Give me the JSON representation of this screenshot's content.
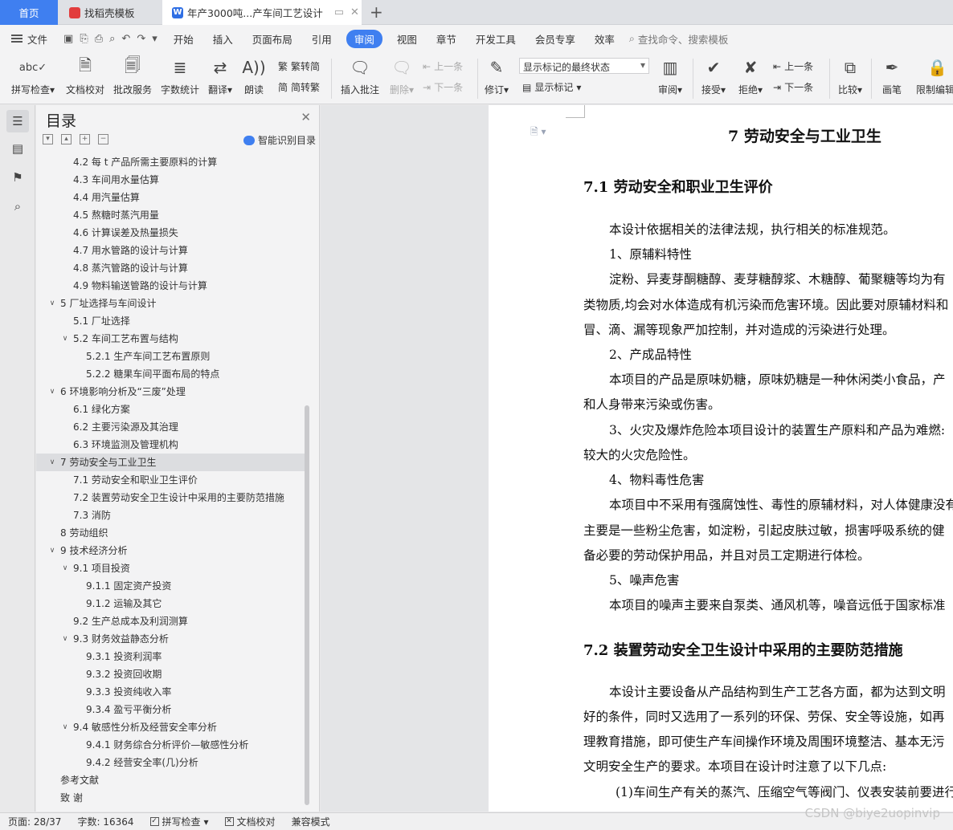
{
  "tabs": {
    "home": "首页",
    "t1": "找稻壳模板",
    "t2": "年产3000吨...产车间工艺设计",
    "add": "+"
  },
  "menu": {
    "file": "文件",
    "items": [
      "开始",
      "插入",
      "页面布局",
      "引用",
      "审阅",
      "视图",
      "章节",
      "开发工具",
      "会员专享",
      "效率"
    ],
    "active": "审阅",
    "search": "查找命令、搜索模板"
  },
  "ribbon": {
    "spell": "拼写检查",
    "proof": "文档校对",
    "batch": "批改服务",
    "wordcount": "字数统计",
    "translate": "翻译",
    "read": "朗读",
    "trad": "繁转简",
    "simp": "简转繁",
    "insert_comment": "插入批注",
    "delete": "删除",
    "prev1": "上一条",
    "next1": "下一条",
    "revise": "修订",
    "markup_select": "显示标记的最终状态",
    "show_markup": "显示标记",
    "review": "审阅",
    "accept": "接受",
    "reject": "拒绝",
    "prev2": "上一条",
    "next2": "下一条",
    "compare": "比较",
    "pen": "画笔",
    "restrict": "限制编辑"
  },
  "toc": {
    "title": "目录",
    "smart": "智能识别目录",
    "items": [
      {
        "label": "4.2  每 t 产品所需主要原料的计算",
        "level": 2,
        "tw": ""
      },
      {
        "label": "4.3  车间用水量估算",
        "level": 2,
        "tw": ""
      },
      {
        "label": "4.4 用汽量估算",
        "level": 2,
        "tw": ""
      },
      {
        "label": "4.5 熬糖时蒸汽用量",
        "level": 2,
        "tw": ""
      },
      {
        "label": "4.6 计算误差及热量损失",
        "level": 2,
        "tw": ""
      },
      {
        "label": "4.7 用水管路的设计与计算",
        "level": 2,
        "tw": ""
      },
      {
        "label": "4.8 蒸汽管路的设计与计算",
        "level": 2,
        "tw": ""
      },
      {
        "label": "4.9 物料输送管路的设计与计算",
        "level": 2,
        "tw": ""
      },
      {
        "label": "5 厂址选择与车间设计",
        "level": 1,
        "tw": "∨"
      },
      {
        "label": "5.1 厂址选择",
        "level": 2,
        "tw": ""
      },
      {
        "label": "5.2 车间工艺布置与结构",
        "level": 2,
        "tw": "∨"
      },
      {
        "label": "5.2.1 生产车间工艺布置原则",
        "level": 3,
        "tw": ""
      },
      {
        "label": "5.2.2 糖果车间平面布局的特点",
        "level": 3,
        "tw": ""
      },
      {
        "label": "6 环境影响分析及“三废”处理",
        "level": 1,
        "tw": "∨"
      },
      {
        "label": "6.1 绿化方案",
        "level": 2,
        "tw": ""
      },
      {
        "label": "6.2 主要污染源及其治理",
        "level": 2,
        "tw": ""
      },
      {
        "label": "6.3 环境监测及管理机构",
        "level": 2,
        "tw": ""
      },
      {
        "label": "7 劳动安全与工业卫生",
        "level": 1,
        "tw": "∨",
        "selected": true
      },
      {
        "label": "7.1 劳动安全和职业卫生评价",
        "level": 2,
        "tw": ""
      },
      {
        "label": "7.2 装置劳动安全卫生设计中采用的主要防范措施",
        "level": 2,
        "tw": ""
      },
      {
        "label": "7.3 消防",
        "level": 2,
        "tw": ""
      },
      {
        "label": "8 劳动组织",
        "level": 1,
        "tw": ""
      },
      {
        "label": "9 技术经济分析",
        "level": 1,
        "tw": "∨"
      },
      {
        "label": "9.1 项目投资",
        "level": 2,
        "tw": "∨"
      },
      {
        "label": "9.1.1 固定资产投资",
        "level": 3,
        "tw": ""
      },
      {
        "label": "9.1.2 运输及其它",
        "level": 3,
        "tw": ""
      },
      {
        "label": "9.2 生产总成本及利润测算",
        "level": 2,
        "tw": ""
      },
      {
        "label": "9.3 财务效益静态分析",
        "level": 2,
        "tw": "∨"
      },
      {
        "label": "9.3.1 投资利润率",
        "level": 3,
        "tw": ""
      },
      {
        "label": "9.3.2 投资回收期",
        "level": 3,
        "tw": ""
      },
      {
        "label": "9.3.3 投资纯收入率",
        "level": 3,
        "tw": ""
      },
      {
        "label": "9.3.4 盈亏平衡分析",
        "level": 3,
        "tw": ""
      },
      {
        "label": "9.4 敏感性分析及经营安全率分析",
        "level": 2,
        "tw": "∨"
      },
      {
        "label": "9.4.1 财务综合分析评价—敏感性分析",
        "level": 3,
        "tw": ""
      },
      {
        "label": "9.4.2 经营安全率(几)分析",
        "level": 3,
        "tw": ""
      },
      {
        "label": "参考文献",
        "level": 1,
        "tw": ""
      },
      {
        "label": "致    谢",
        "level": 1,
        "tw": ""
      }
    ]
  },
  "doc": {
    "h1": "7 劳动安全与工业卫生",
    "h2a": "7.1 劳动安全和职业卫生评价",
    "p1": "本设计依据相关的法律法规，执行相关的标准规范。",
    "p2": "1、原辅料特性",
    "p3": "淀粉、异麦芽酮糖醇、麦芽糖醇浆、木糖醇、葡聚糖等均为有",
    "p4": "类物质,均会对水体造成有机污染而危害环境。因此要对原辅材料和",
    "p5": "冒、滴、漏等现象严加控制，并对造成的污染进行处理。",
    "p6": "2、产成品特性",
    "p7": "本项目的产品是原味奶糖，原味奶糖是一种休闲类小食品，产",
    "p8": "和人身带来污染或伤害。",
    "p9": "3、火灾及爆炸危险本项目设计的装置生产原料和产品为难燃:",
    "p10": "较大的火灾危险性。",
    "p11": "4、物料毒性危害",
    "p12": "本项目中不采用有强腐蚀性、毒性的原辅材料，对人体健康没有",
    "p13": "主要是一些粉尘危害，如淀粉，引起皮肤过敏，损害呼吸系统的健",
    "p14": "备必要的劳动保护用品，并且对员工定期进行体检。",
    "p15": "5、噪声危害",
    "p16": "本项目的噪声主要来自泵类、通风机等，噪音远低于国家标准",
    "h2b": "7.2 装置劳动安全卫生设计中采用的主要防范措施",
    "p17": "本设计主要设备从产品结构到生产工艺各方面，都为达到文明",
    "p18": "好的条件，同时又选用了一系列的环保、劳保、安全等设施，如再",
    "p19": "理教育措施，即可使生产车间操作环境及周围环境整洁、基本无污",
    "p20": "文明安全生产的要求。本项目在设计时注意了以下几点:",
    "p21": "(1)车间生产有关的蒸汽、压缩空气等阀门、仪表安装前要进行"
  },
  "status": {
    "page": "页面: 28/37",
    "words": "字数: 16364",
    "spell": "拼写检查",
    "proof": "文档校对",
    "compat": "兼容模式"
  },
  "watermark": "CSDN @biye2uopinvip"
}
